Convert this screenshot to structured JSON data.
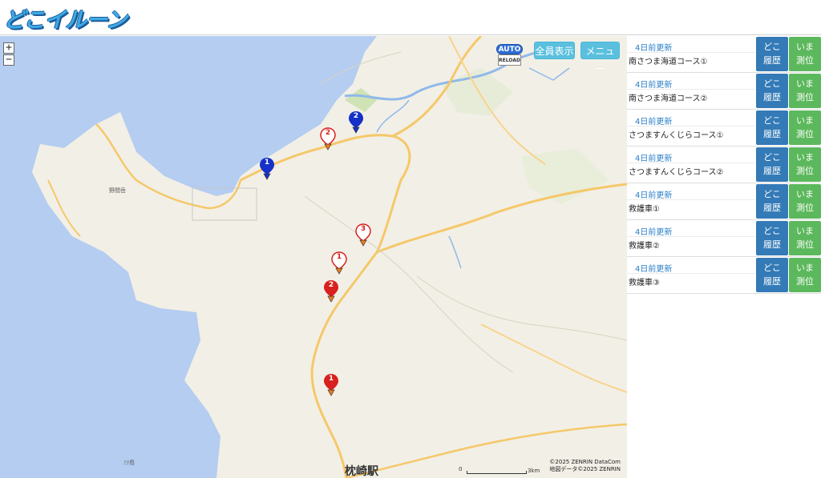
{
  "app": {
    "logo_text": "どこイルーン"
  },
  "map": {
    "zoom_in": "+",
    "zoom_out": "−",
    "auto_top": "AUTO",
    "auto_bottom": "RELOAD",
    "show_all_label": "全員表示",
    "menu_label": "メニュー",
    "copyright_line1": "©2025 ZENRIN DataCom",
    "copyright_line2": "地図データ©2025 ZENRIN",
    "scale_start": "0",
    "scale_end": "3km",
    "place_mountain": "野間岳",
    "place_station": "枕崎駅",
    "place_bottom_left": "ﾐﾂ島",
    "colors": {
      "sea": "#b4cdf0",
      "land": "#f2efe6",
      "road": "#f5c86a",
      "river": "#8fb9ea",
      "marker_blue": "#1531c8",
      "marker_red": "#d8201f"
    },
    "markers": [
      {
        "label": "1",
        "style": "blue-filled"
      },
      {
        "label": "2",
        "style": "blue-filled"
      },
      {
        "label": "2",
        "style": "red-outline"
      },
      {
        "label": "3",
        "style": "red-outline"
      },
      {
        "label": "1",
        "style": "red-outline"
      },
      {
        "label": "2",
        "style": "red-filled"
      },
      {
        "label": "1",
        "style": "red-filled"
      }
    ]
  },
  "vehicles": [
    {
      "updated": "4日前更新",
      "name": "南さつま海道コース①",
      "doko_line1": "どこ",
      "doko_line2": "履歴",
      "ima_line1": "いま",
      "ima_line2": "測位"
    },
    {
      "updated": "4日前更新",
      "name": "南さつま海道コース②",
      "doko_line1": "どこ",
      "doko_line2": "履歴",
      "ima_line1": "いま",
      "ima_line2": "測位"
    },
    {
      "updated": "4日前更新",
      "name": "さつますんくじらコース①",
      "doko_line1": "どこ",
      "doko_line2": "履歴",
      "ima_line1": "いま",
      "ima_line2": "測位"
    },
    {
      "updated": "4日前更新",
      "name": "さつますんくじらコース②",
      "doko_line1": "どこ",
      "doko_line2": "履歴",
      "ima_line1": "いま",
      "ima_line2": "測位"
    },
    {
      "updated": "4日前更新",
      "name": "救護車①",
      "doko_line1": "どこ",
      "doko_line2": "履歴",
      "ima_line1": "いま",
      "ima_line2": "測位"
    },
    {
      "updated": "4日前更新",
      "name": "救護車②",
      "doko_line1": "どこ",
      "doko_line2": "履歴",
      "ima_line1": "いま",
      "ima_line2": "測位"
    },
    {
      "updated": "4日前更新",
      "name": "救護車③",
      "doko_line1": "どこ",
      "doko_line2": "履歴",
      "ima_line1": "いま",
      "ima_line2": "測位"
    }
  ]
}
